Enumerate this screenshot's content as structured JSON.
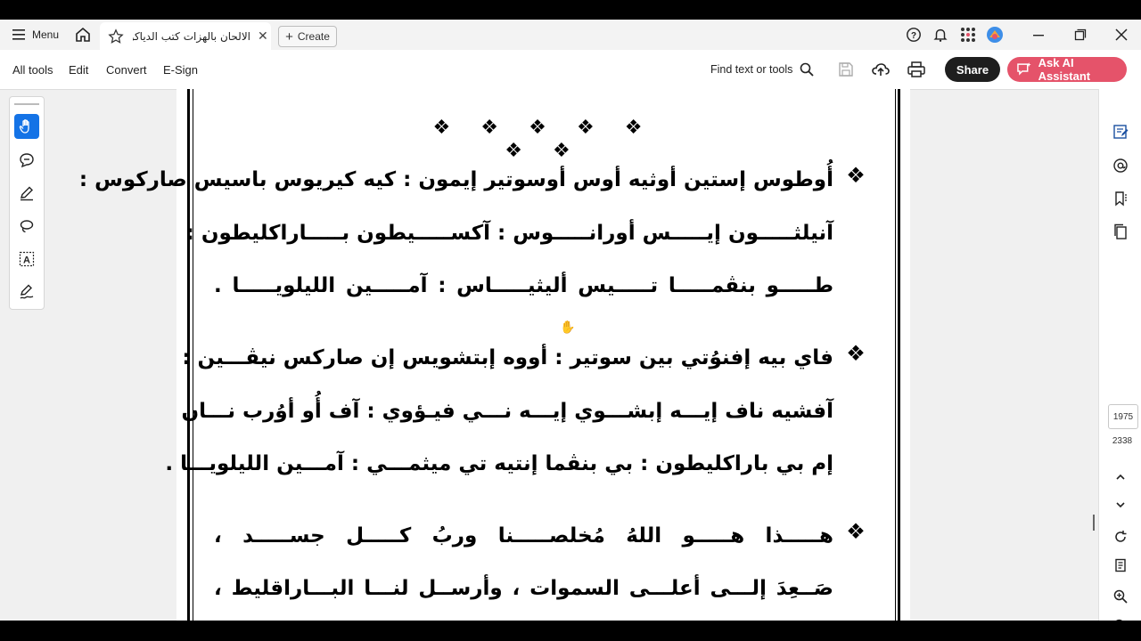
{
  "titlebar": {
    "menu_label": "Menu",
    "tab_title": "الالحان بالهزات كتب الدياكون..",
    "create_label": "Create"
  },
  "toolbar": {
    "items": [
      "All tools",
      "Edit",
      "Convert",
      "E-Sign"
    ],
    "find_label": "Find text or tools",
    "share_label": "Share",
    "ai_label": "Ask AI Assistant"
  },
  "document": {
    "ornaments": "❖ ❖ ❖ ❖ ❖ ❖ ❖",
    "bullet": "❖",
    "paragraphs": [
      {
        "lines": [
          "أُوطوس إستين أوثيه أوس أوسوتير إيمون : كيه كيريوس باسيس صاركوس :",
          "آنيلثـــــون إيـــــس أورانـــــوس : آكســـــيطون بـــــاراكليطون :",
          "طـــــو بنڤمـــــا تـــــيس أليثيـــــاس : آمـــــين الليلويـــــا ."
        ]
      },
      {
        "lines": [
          "فاي بيه إفنوُتي بين سوتير : أووه إبتشويس إن صاركس نيڤـــين :",
          "آفشيه ناف إيـــه إبشـــوي إيـــه نـــي فيـؤوي : آف أُو أوُرب نـــان",
          "إم بي باراكليطون : بي بنڤما إنتيه تي ميثمـــي : آمـــين الليلويـــا ."
        ]
      },
      {
        "lines": [
          "هـــــذا هـــــو اللهُ مُخلصـــــنا وربُ كـــــل جســـــد ،",
          "صَــعِدَ إلـــى أعلـــى السموات ، وأرســل لنـــا البـــاراقليط ،"
        ]
      }
    ]
  },
  "page_nav": {
    "current_page": "1975",
    "total_pages": "2338"
  }
}
